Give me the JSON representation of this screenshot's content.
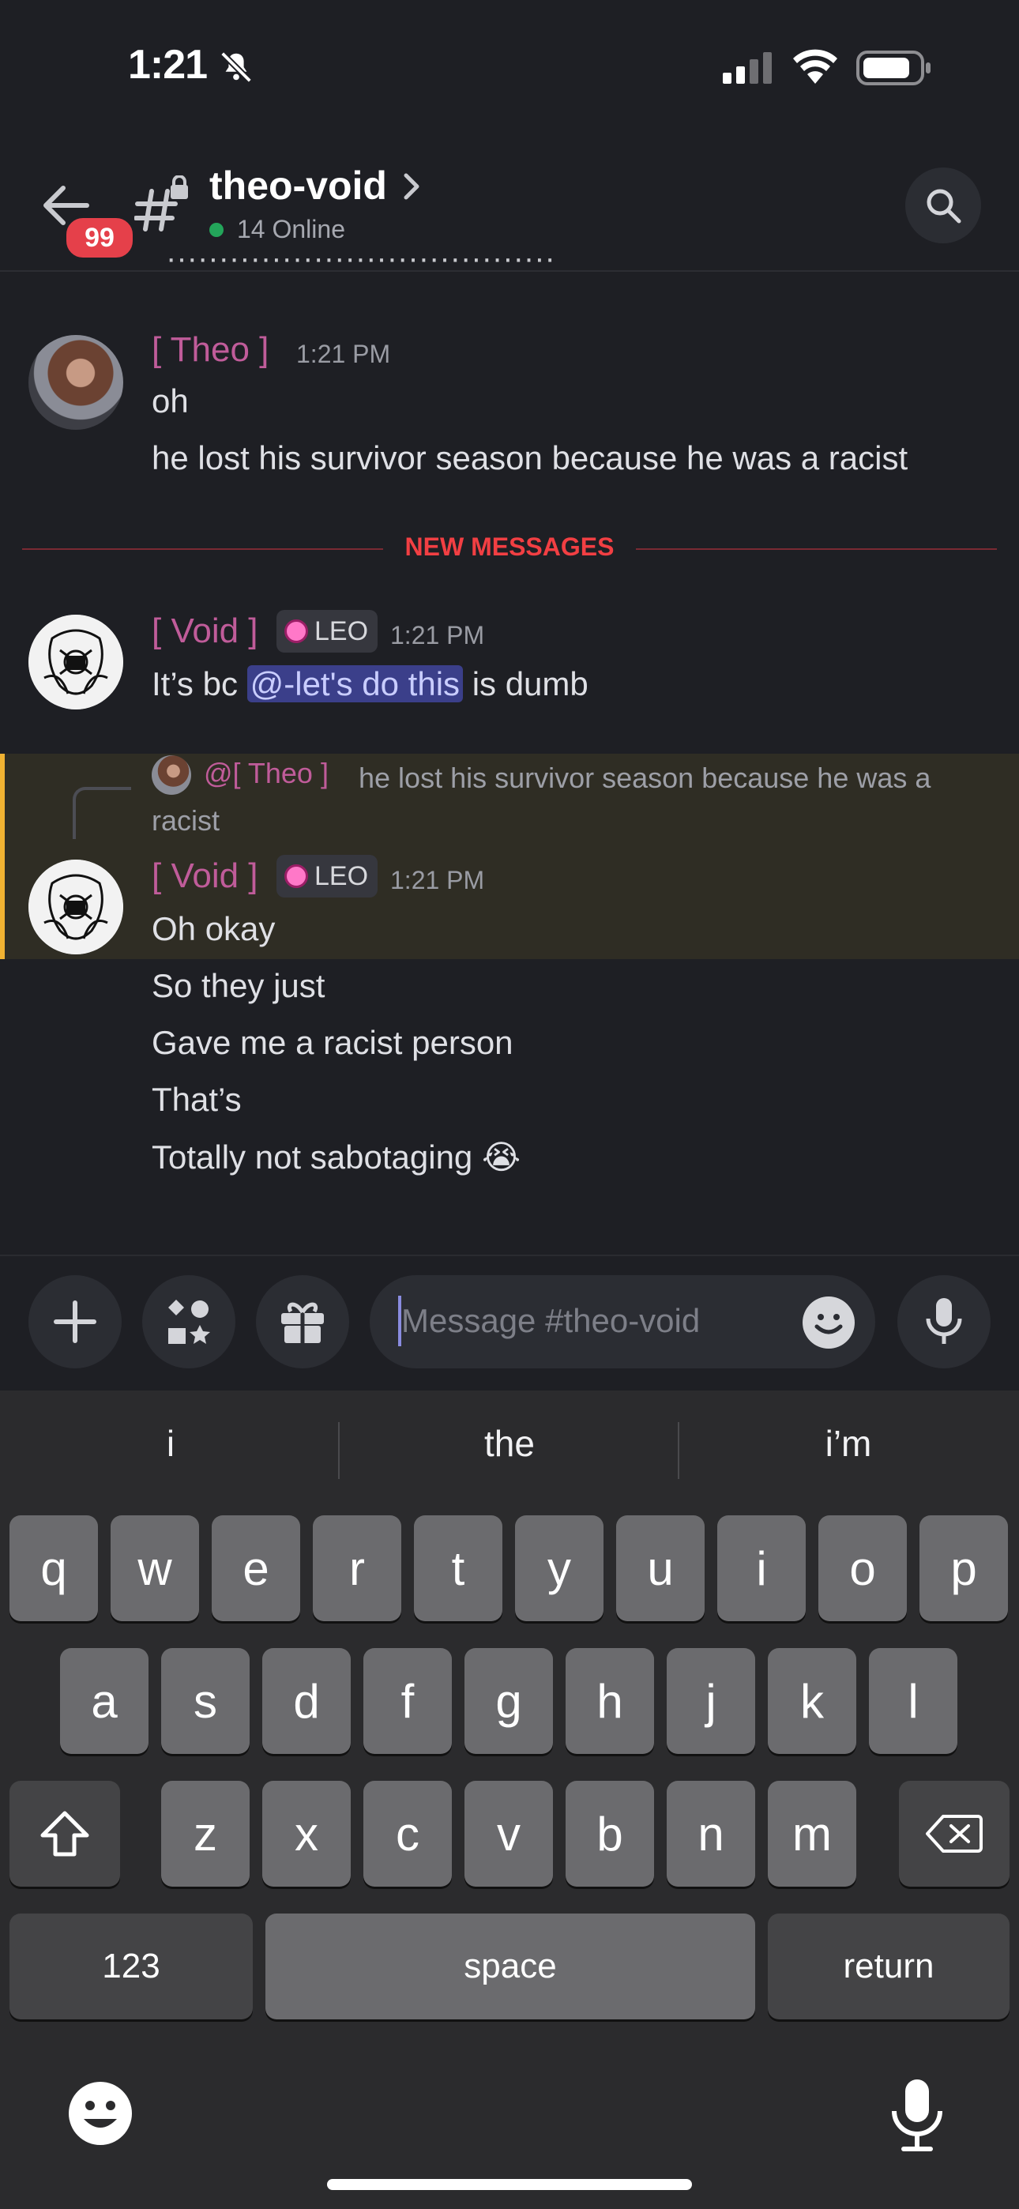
{
  "status_bar": {
    "time": "1:21"
  },
  "header": {
    "unread_badge": "99",
    "channel_name": "theo-void",
    "online_count": "14 Online"
  },
  "messages": [
    {
      "username": "[ Theo ]",
      "timestamp": "1:21 PM",
      "lines": [
        "oh",
        "he lost his survivor season because he was a racist"
      ]
    },
    {
      "username": "[ Void ]",
      "role": "LEO",
      "timestamp": "1:21 PM",
      "text_before": "It’s bc ",
      "mention": "@-let's do this",
      "text_after": " is dumb"
    },
    {
      "username": "[ Void ]",
      "role": "LEO",
      "timestamp": "1:21 PM",
      "reply": {
        "username": "@[ Theo ]",
        "text": "he lost his survivor season because he was a racist"
      },
      "lines": [
        "Oh okay",
        "So they just",
        "Gave me a racist person",
        "That’s",
        "Totally not sabotaging 😭"
      ]
    }
  ],
  "new_messages_label": "NEW MESSAGES",
  "composer": {
    "placeholder": "Message #theo-void"
  },
  "keyboard": {
    "suggestions": [
      "i",
      "the",
      "i’m"
    ],
    "row1": [
      "q",
      "w",
      "e",
      "r",
      "t",
      "y",
      "u",
      "i",
      "o",
      "p"
    ],
    "row2": [
      "a",
      "s",
      "d",
      "f",
      "g",
      "h",
      "j",
      "k",
      "l"
    ],
    "row3": [
      "z",
      "x",
      "c",
      "v",
      "b",
      "n",
      "m"
    ],
    "numbers_label": "123",
    "space_label": "space",
    "return_label": "return"
  },
  "colors": {
    "accent_mention": "#3b3f8a",
    "new_messages": "#f23f43",
    "online": "#23a55a",
    "highlight_bar": "#f0b232"
  }
}
